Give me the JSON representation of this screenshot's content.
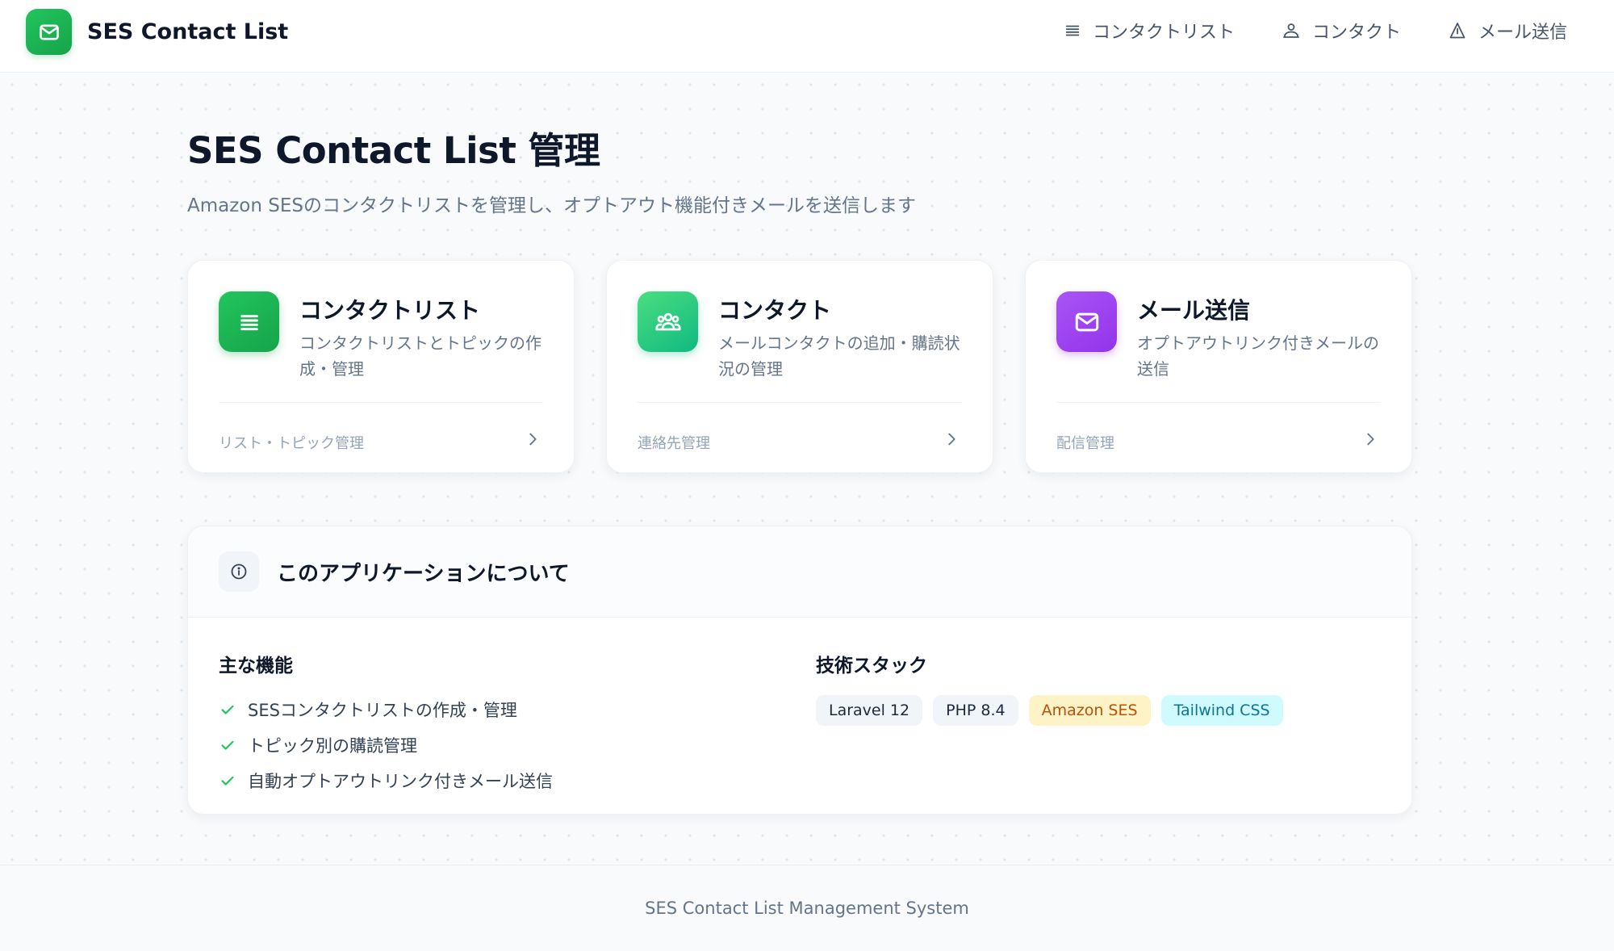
{
  "app": {
    "name": "SES Contact List"
  },
  "nav": [
    {
      "label": "コンタクトリスト",
      "icon": "list-icon"
    },
    {
      "label": "コンタクト",
      "icon": "user-icon"
    },
    {
      "label": "メール送信",
      "icon": "send-icon"
    }
  ],
  "page": {
    "title": "SES Contact List 管理",
    "subtitle": "Amazon SESのコンタクトリストを管理し、オプトアウト機能付きメールを送信します"
  },
  "cards": [
    {
      "title": "コンタクトリスト",
      "description": "コンタクトリストとトピックの作成・管理",
      "footer": "リスト・トピック管理",
      "icon": "list-icon",
      "color": "#22c55e"
    },
    {
      "title": "コンタクト",
      "description": "メールコンタクトの追加・購読状況の管理",
      "footer": "連絡先管理",
      "icon": "users-icon",
      "color": "#34d399"
    },
    {
      "title": "メール送信",
      "description": "オプトアウトリンク付きメールの送信",
      "footer": "配信管理",
      "icon": "mail-icon",
      "color": "#a855f7"
    }
  ],
  "about": {
    "title": "このアプリケーションについて",
    "features_heading": "主な機能",
    "features": [
      "SESコンタクトリストの作成・管理",
      "トピック別の購読管理",
      "自動オプトアウトリンク付きメール送信"
    ],
    "stack_heading": "技術スタック",
    "stack": [
      {
        "label": "Laravel 12",
        "bg": "#f1f5f9",
        "fg": "#1e293b"
      },
      {
        "label": "PHP 8.4",
        "bg": "#f1f5f9",
        "fg": "#1e293b"
      },
      {
        "label": "Amazon SES",
        "bg": "#fef3c7",
        "fg": "#b45309"
      },
      {
        "label": "Tailwind CSS",
        "bg": "#cffafe",
        "fg": "#0e7490"
      }
    ]
  },
  "footer": {
    "text": "SES Contact List Management System"
  },
  "colors": {
    "brand": "#22c55e",
    "check": "#22c55e"
  }
}
